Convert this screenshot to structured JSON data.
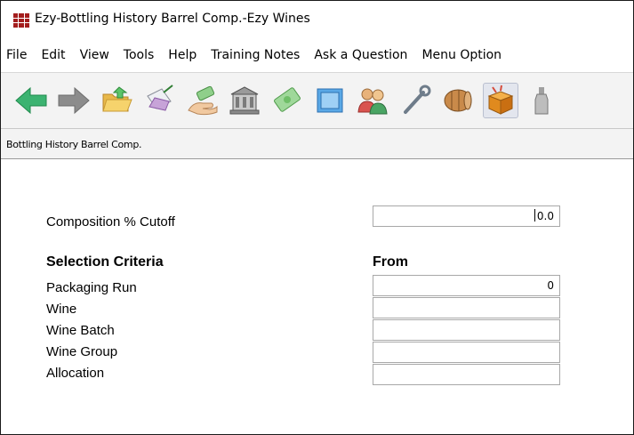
{
  "window": {
    "title": "Ezy-Bottling History Barrel Comp.-Ezy Wines",
    "app_icon": "winery-grid-icon",
    "app_icon_color": "#a41e1e"
  },
  "menu": {
    "items": [
      "File",
      "Edit",
      "View",
      "Tools",
      "Help",
      "Training Notes",
      "Ask a Question",
      "Menu Option"
    ]
  },
  "toolbar": {
    "buttons": [
      {
        "icon": "back-arrow-icon"
      },
      {
        "icon": "forward-arrow-icon"
      },
      {
        "icon": "open-folder-icon"
      },
      {
        "icon": "sign-document-icon"
      },
      {
        "icon": "hand-money-icon"
      },
      {
        "icon": "bank-building-icon"
      },
      {
        "icon": "money-bill-icon"
      },
      {
        "icon": "stamp-icon"
      },
      {
        "icon": "users-icon"
      },
      {
        "icon": "wrench-icon"
      },
      {
        "icon": "barrel-icon"
      },
      {
        "icon": "box-icon",
        "active": true
      },
      {
        "icon": "bottle-icon"
      }
    ]
  },
  "breadcrumb": "Bottling History Barrel Comp.",
  "form": {
    "cutoff_label": "Composition % Cutoff",
    "cutoff_value": "0.0",
    "selection_header": "Selection Criteria",
    "from_header": "From",
    "fields": [
      {
        "label": "Packaging Run",
        "value": "0"
      },
      {
        "label": "Wine",
        "value": ""
      },
      {
        "label": "Wine Batch",
        "value": ""
      },
      {
        "label": "Wine Group",
        "value": ""
      },
      {
        "label": "Allocation",
        "value": ""
      }
    ]
  }
}
